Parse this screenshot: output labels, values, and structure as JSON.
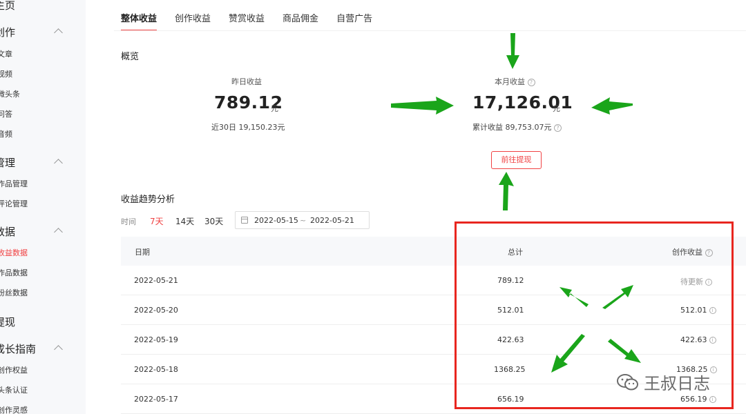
{
  "sidebar": {
    "items": [
      {
        "label": "主页",
        "type": "group",
        "chevron": false
      },
      {
        "label": "创作",
        "type": "group",
        "chevron": true
      },
      {
        "label": "文章",
        "type": "sub"
      },
      {
        "label": "视频",
        "type": "sub"
      },
      {
        "label": "微头条",
        "type": "sub"
      },
      {
        "label": "问答",
        "type": "sub"
      },
      {
        "label": "音频",
        "type": "sub"
      },
      {
        "label": "管理",
        "type": "group",
        "chevron": true
      },
      {
        "label": "作品管理",
        "type": "sub"
      },
      {
        "label": "评论管理",
        "type": "sub"
      },
      {
        "label": "数据",
        "type": "group",
        "chevron": true
      },
      {
        "label": "收益数据",
        "type": "sub",
        "active": true
      },
      {
        "label": "作品数据",
        "type": "sub"
      },
      {
        "label": "粉丝数据",
        "type": "sub"
      },
      {
        "label": "提现",
        "type": "group",
        "chevron": false
      },
      {
        "label": "成长指南",
        "type": "group",
        "chevron": true
      },
      {
        "label": "创作权益",
        "type": "sub"
      },
      {
        "label": "头条认证",
        "type": "sub"
      },
      {
        "label": "创作灵感",
        "type": "sub"
      }
    ]
  },
  "tabs": [
    "整体收益",
    "创作收益",
    "赞赏收益",
    "商品佣金",
    "自营广告"
  ],
  "overview": {
    "title": "概览",
    "yesterday_label": "昨日收益",
    "yesterday_value": "789.12",
    "yesterday_unit": "元",
    "last30_text": "近30日 19,150.23元",
    "month_label": "本月收益",
    "month_value": "17,126.01",
    "month_unit": "元",
    "total_text": "累计收益 89,753.07元",
    "withdraw_button": "前往提现"
  },
  "trend": {
    "title": "收益趋势分析",
    "time_label": "时间",
    "options": [
      "7天",
      "14天",
      "30天"
    ],
    "active_option": "7天",
    "date_start": "2022-05-15",
    "date_sep": "~",
    "date_end": "2022-05-21"
  },
  "table": {
    "headers": [
      "日期",
      "总计",
      "创作收益"
    ],
    "rows": [
      {
        "date": "2022-05-21",
        "total": "789.12",
        "creation": "待更新"
      },
      {
        "date": "2022-05-20",
        "total": "512.01",
        "creation": "512.01"
      },
      {
        "date": "2022-05-19",
        "total": "422.63",
        "creation": "422.63"
      },
      {
        "date": "2022-05-18",
        "total": "1368.25",
        "creation": "1368.25"
      },
      {
        "date": "2022-05-17",
        "total": "656.19",
        "creation": "656.19"
      }
    ]
  },
  "watermark": "王叔日志",
  "colors": {
    "accent": "#f04142",
    "annotation_box": "#e8261f",
    "annotation_arrow": "#1aa51a"
  }
}
